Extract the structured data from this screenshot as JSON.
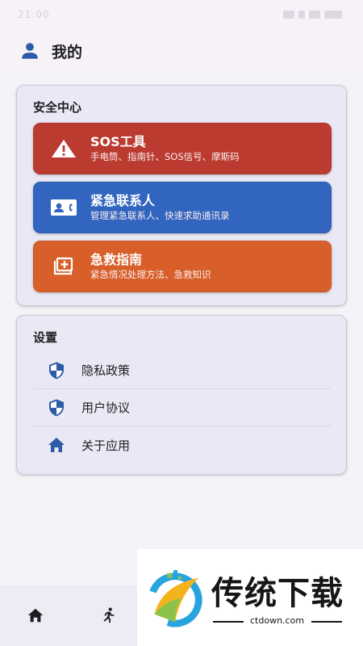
{
  "status_bar": {
    "time": "21:00"
  },
  "header": {
    "title": "我的",
    "icon": "person-icon"
  },
  "safety": {
    "title": "安全中心",
    "items": [
      {
        "name": "SOS工具",
        "desc": "手电筒、指南针、SOS信号、摩斯码",
        "icon": "warning-icon",
        "color": "#bb3b30"
      },
      {
        "name": "紧急联系人",
        "desc": "管理紧急联系人、快速求助通讯录",
        "icon": "contact-card-icon",
        "color": "#3165bf"
      },
      {
        "name": "急救指南",
        "desc": "紧急情况处理方法、急救知识",
        "icon": "first-aid-icon",
        "color": "#d85f2a"
      }
    ]
  },
  "settings": {
    "title": "设置",
    "items": [
      {
        "label": "隐私政策",
        "icon": "shield-icon"
      },
      {
        "label": "用户协议",
        "icon": "shield-icon"
      },
      {
        "label": "关于应用",
        "icon": "home-icon"
      }
    ]
  },
  "bottom_nav": {
    "items": [
      {
        "icon": "home-icon"
      },
      {
        "icon": "running-icon"
      }
    ]
  },
  "watermark": {
    "title": "传统下载",
    "url": "ctdown.com"
  },
  "colors": {
    "accent": "#2d5ba8",
    "card_bg": "#e9e8f4",
    "page_bg": "#f3f3f8"
  }
}
